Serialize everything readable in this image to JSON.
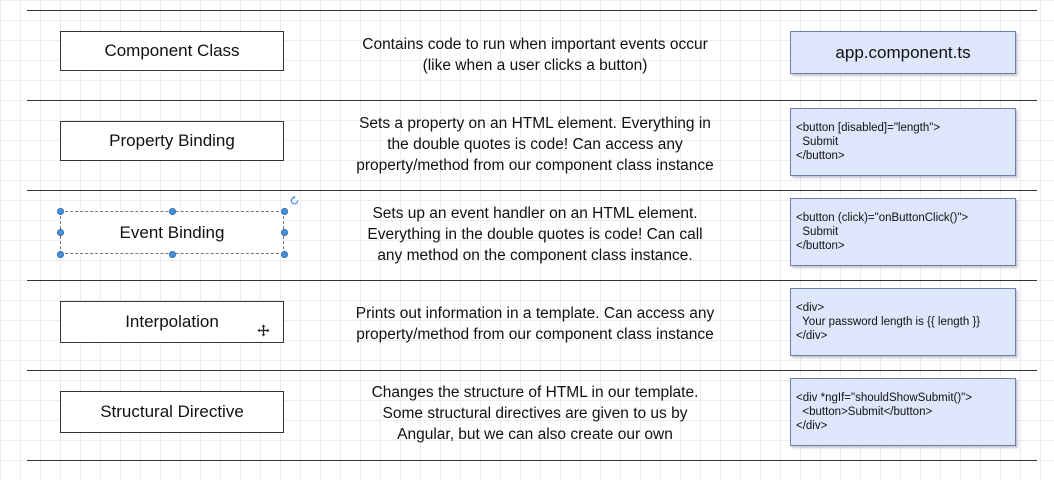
{
  "rows": [
    {
      "label": "Component Class",
      "description": "Contains code to run when important events occur\n(like when a user clicks a button)",
      "code": "app.component.ts"
    },
    {
      "label": "Property Binding",
      "description": "Sets a property on an HTML element.  Everything in\nthe double quotes is code!  Can access any\nproperty/method from our component class instance",
      "code": "<button [disabled]=\"length\">\n  Submit\n</button>"
    },
    {
      "label": "Event Binding",
      "description": "Sets up an event handler on an HTML element.\nEverything in the double quotes is code!  Can call\nany method on the component class instance.",
      "code": "<button (click)=\"onButtonClick()\">\n  Submit\n</button>"
    },
    {
      "label": "Interpolation",
      "description": "Prints out information in a template.  Can access any\nproperty/method from our component class instance",
      "code": "<div>\n  Your password length is {{ length }}\n</div>"
    },
    {
      "label": "Structural Directive",
      "description": "Changes the structure of HTML in our template.\nSome structural directives are given to us by\nAngular, but we can also create our own",
      "code": "<div *ngIf=\"shouldShowSubmit()\">\n  <button>Submit</button>\n</div>"
    }
  ],
  "icons": {
    "rotate": "rotate-icon",
    "move": "move-cursor-icon"
  },
  "colors": {
    "code_box_fill": "#dde6fb",
    "code_box_border": "#6f7ea7",
    "selection_handle": "#4a90d9"
  }
}
